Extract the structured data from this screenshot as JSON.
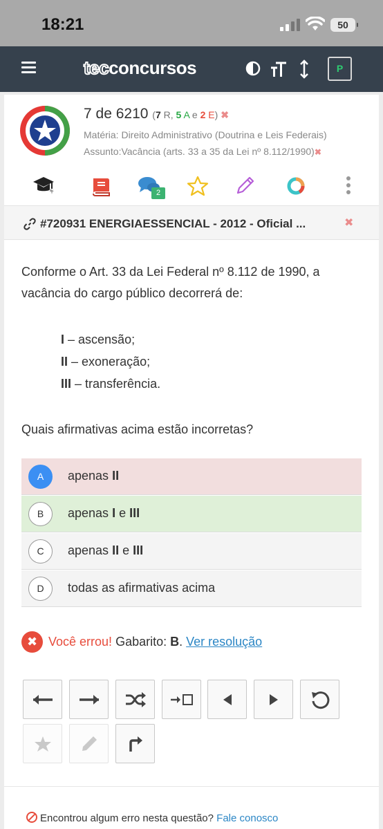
{
  "status_bar": {
    "time": "18:21",
    "battery": "50"
  },
  "app": {
    "logo_prefix": "tec",
    "logo_suffix": "concursos",
    "profile_button": "P"
  },
  "question_info": {
    "position": "7 de 6210",
    "open_paren": "(",
    "r_count": "7",
    "r_label": " R, ",
    "a_count": "5",
    "a_label": " A",
    "e_sep": " e ",
    "e_count": "2",
    "e_label": " E",
    "close_paren": ")",
    "materia": "Matéria: Direito Administrativo (Doutrina e Leis Federais)",
    "assunto": "Assunto:Vacância (arts. 33 a 35 da Lei nº 8.112/1990)",
    "clear_symbol": "✖",
    "comments_badge": "2"
  },
  "question_header": {
    "title": "#720931 ENERGIAESSENCIAL - 2012 - Oficial ...",
    "close_symbol": "✖"
  },
  "statement": {
    "text": "Conforme o Art. 33 da Lei Federal nº 8.112 de 1990, a vacância do cargo público decorrerá de:",
    "items": [
      {
        "roman": "I",
        "text": " – ascensão;"
      },
      {
        "roman": "II",
        "text": " – exoneração;"
      },
      {
        "roman": "III",
        "text": " – transferência."
      }
    ],
    "question": "Quais afirmativas acima estão incorretas?"
  },
  "options": [
    {
      "letter": "A",
      "pre": "apenas ",
      "b1": "II",
      "mid": "",
      "b2": "",
      "state": "wrong-selected"
    },
    {
      "letter": "B",
      "pre": "apenas ",
      "b1": "I",
      "mid": " e ",
      "b2": "III",
      "state": "correct"
    },
    {
      "letter": "C",
      "pre": "apenas ",
      "b1": "II",
      "mid": " e ",
      "b2": "III",
      "state": "neutral"
    },
    {
      "letter": "D",
      "pre": "todas as afirmativas acima",
      "b1": "",
      "mid": "",
      "b2": "",
      "state": "neutral"
    }
  ],
  "result": {
    "error_text": "Você errou!",
    "answer_label": " Gabarito: ",
    "answer": "B",
    "answer_suffix": ". ",
    "link": "Ver resolução"
  },
  "footer": {
    "text": "Encontrou algum erro nesta questão? ",
    "link": "Fale conosco"
  },
  "colors": {
    "topbar": "#36414d",
    "wrong_bg": "#f2dede",
    "correct_bg": "#dff0d8",
    "neutral_bg": "#f4f4f4",
    "selected_circle": "#3b8ff3",
    "error": "#e74c3c",
    "link": "#2b86c5"
  }
}
